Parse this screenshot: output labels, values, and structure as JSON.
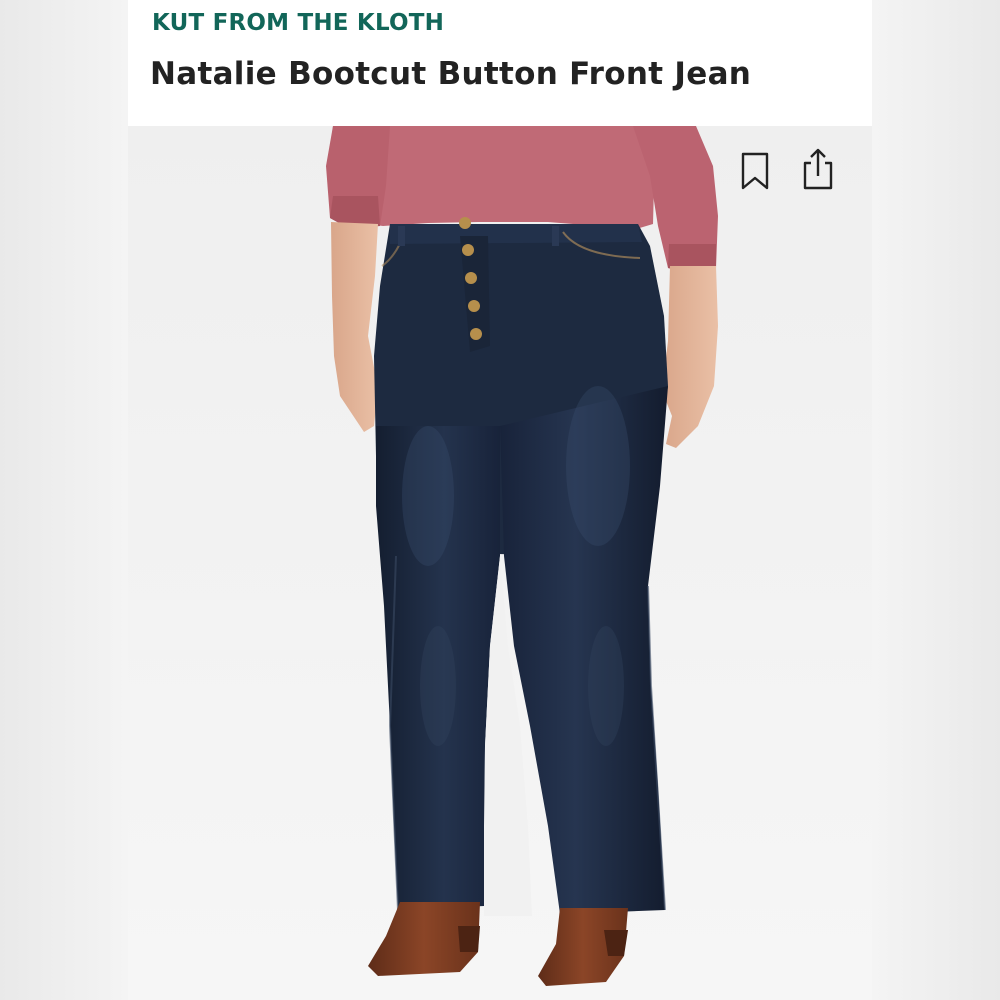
{
  "product": {
    "brand": "KUT FROM THE KLOTH",
    "name": "Natalie Bootcut Button Front Jean"
  },
  "actions": {
    "bookmark_icon": "bookmark-icon",
    "share_icon": "share-icon"
  },
  "colors": {
    "brand_text": "#126659",
    "title_text": "#222222",
    "sweater": "#c06a76",
    "denim": "#1d2a40",
    "boots": "#7a3c22"
  }
}
